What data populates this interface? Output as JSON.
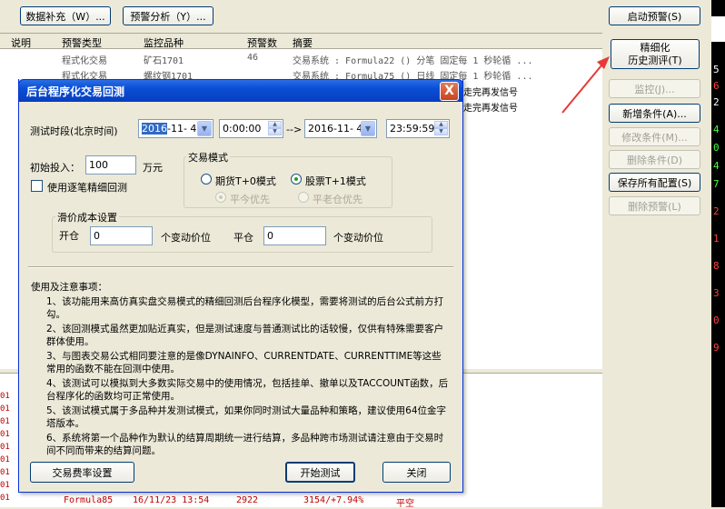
{
  "toolbar": {
    "supplement_label": "数据补充（W）...",
    "analysis_label": "预警分析（Y）..."
  },
  "grid": {
    "headers": [
      "说明",
      "预警类型",
      "监控品种",
      "预警数",
      "摘要"
    ],
    "rows": [
      {
        "type": "程式化交易",
        "variety": "矿石1701",
        "count": "46",
        "summary": "交易系统 : Formula22 () 分笔 固定每 1 秒轮循 ..."
      },
      {
        "type": "程式化交易",
        "variety": "螺纹钢1701",
        "count": "",
        "summary": "交易系统 : Formula75 () 日线 固定每 1 秒轮循 ..."
      },
      {
        "type": "",
        "variety": "",
        "count": "",
        "summary": "走完再发信号"
      },
      {
        "type": "",
        "variety": "",
        "count": "",
        "summary": "走完再发信号"
      }
    ]
  },
  "bottom_grid": {
    "row_markers": [
      "01",
      "01",
      "01",
      "01",
      "01",
      "01",
      "01",
      "01",
      "01"
    ],
    "last_row": {
      "formula": "Formula85",
      "datetime": "16/11/23 13:54",
      "value": "2922",
      "ratio": "3154/+7.94%",
      "direction": "平空"
    }
  },
  "right_panel": {
    "start_alert": "启动预警(S)",
    "fine_history_1": "精细化",
    "fine_history_2": "历史测评(T)",
    "monitor": "监控(J)...",
    "add_condition": "新增条件(A)...",
    "modify_condition": "修改条件(M)...",
    "delete_condition": "删除条件(D)",
    "save_all": "保存所有配置(S)",
    "delete_alert": "删除预警(L)"
  },
  "dark_strip": [
    "5",
    "6",
    "2",
    "4",
    "0",
    "4",
    "7",
    "2",
    "1",
    "8",
    "3",
    "0",
    "9"
  ],
  "dialog": {
    "title": "后台程序化交易回测",
    "close_label": "X",
    "period_label": "测试时段(北京时间)",
    "start_date": {
      "year": "2016",
      "rest": "-11- 4"
    },
    "start_time": "0:00:00",
    "arrow_text": "-->",
    "end_date": "2016-11- 4",
    "end_time": "23:59:59",
    "initial_label": "初始投入：",
    "initial_value": "100",
    "initial_unit": "万元",
    "fine_check_label": "使用逐笔精细回测",
    "trade_mode_title": "交易模式",
    "mode_futures": "期货T+0模式",
    "mode_stock": "股票T+1模式",
    "sub_today": "平今优先",
    "sub_old": "平老仓优先",
    "slippage_title": "滑价成本设置",
    "open_label": "开仓",
    "open_value": "0",
    "open_unit": "个变动价位",
    "close_pos_label": "平仓",
    "close_value": "0",
    "close_unit": "个变动价位",
    "notes_title": "使用及注意事项：",
    "notes": [
      "1、该功能用来高仿真实盘交易模式的精细回测后台程序化模型，需要将测试的后台公式前方打勾。",
      "2、该回测模式虽然更加贴近真实，但是测试速度与普通测试比的话较慢，仅供有特殊需要客户群体使用。",
      "3、与图表交易公式相同要注意的是像DYNAINFO、CURRENTDATE、CURRENTTIME等这些常用的函数不能在回测中使用。",
      "4、该测试可以模拟到大多数实际交易中的使用情况，包括挂单、撤单以及TACCOUNT函数，后台程序化的函数均可正常使用。",
      "5、该测试模式属于多品种并发测试模式，如果你同时测试大量品种和策略，建议使用64位金字塔版本。",
      "6、系统将第一个品种作为默认的结算周期统一进行结算，多品种跨市场测试请注意由于交易时间不同而带来的结算问题。"
    ],
    "fee_button": "交易费率设置",
    "start_button": "开始测试",
    "close_button": "关闭"
  },
  "colors": {
    "accent": "#e53a3a",
    "title_bar": "#0a4ed6",
    "selection": "#316ac5"
  }
}
